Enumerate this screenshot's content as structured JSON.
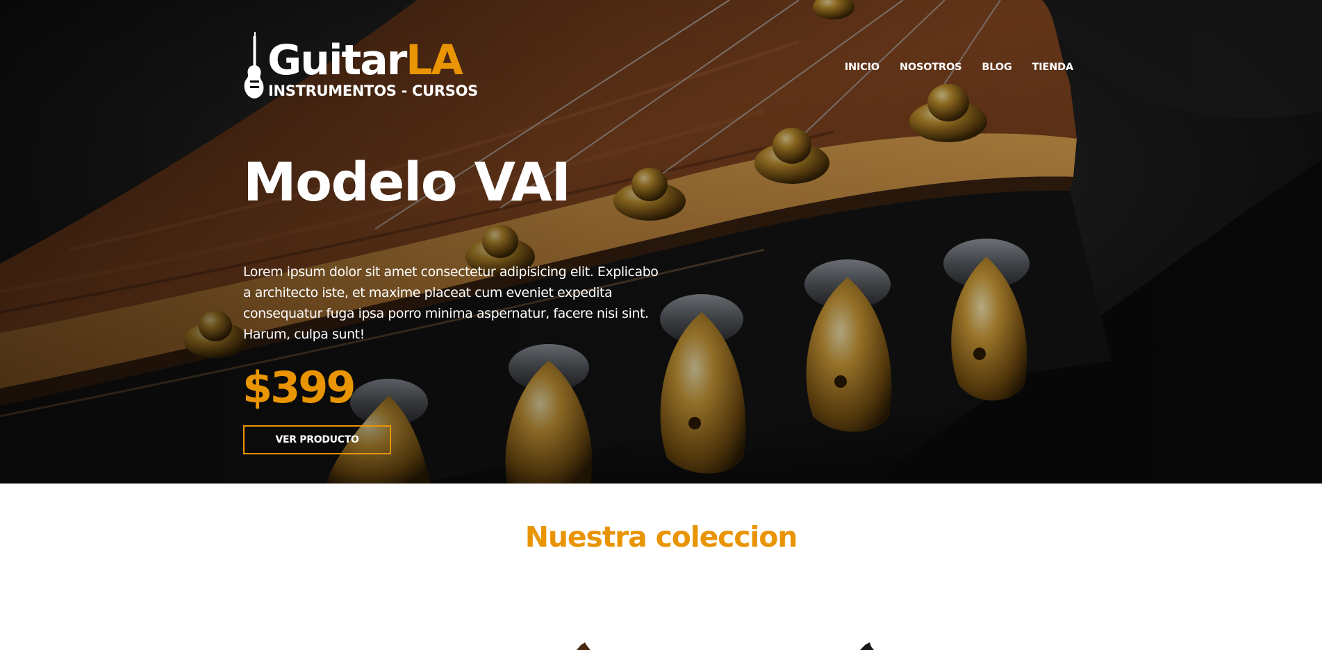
{
  "colors": {
    "accent": "#e99402",
    "hero_text": "#ffffff",
    "page_background": "#ffffff"
  },
  "header": {
    "logo": {
      "word_main": "Guitar",
      "word_accent": "LA",
      "tagline": "INSTRUMENTOS - CURSOS",
      "icon": "electric-guitar-icon"
    },
    "nav": [
      {
        "label": "INICIO"
      },
      {
        "label": "NOSOTROS"
      },
      {
        "label": "BLOG"
      },
      {
        "label": "TIENDA"
      }
    ]
  },
  "hero": {
    "title": "Modelo VAI",
    "description": "Lorem ipsum dolor sit amet consectetur adipisicing elit. Explicabo a architecto iste, et maxime placeat cum eveniet expedita consequatur fuga ipsa porro minima aspernatur, facere nisi sint. Harum, culpa sunt!",
    "price": "$399",
    "button_label": "VER PRODUCTO",
    "background": "guitar-headstock-image"
  },
  "collection": {
    "title": "Nuestra coleccion"
  }
}
